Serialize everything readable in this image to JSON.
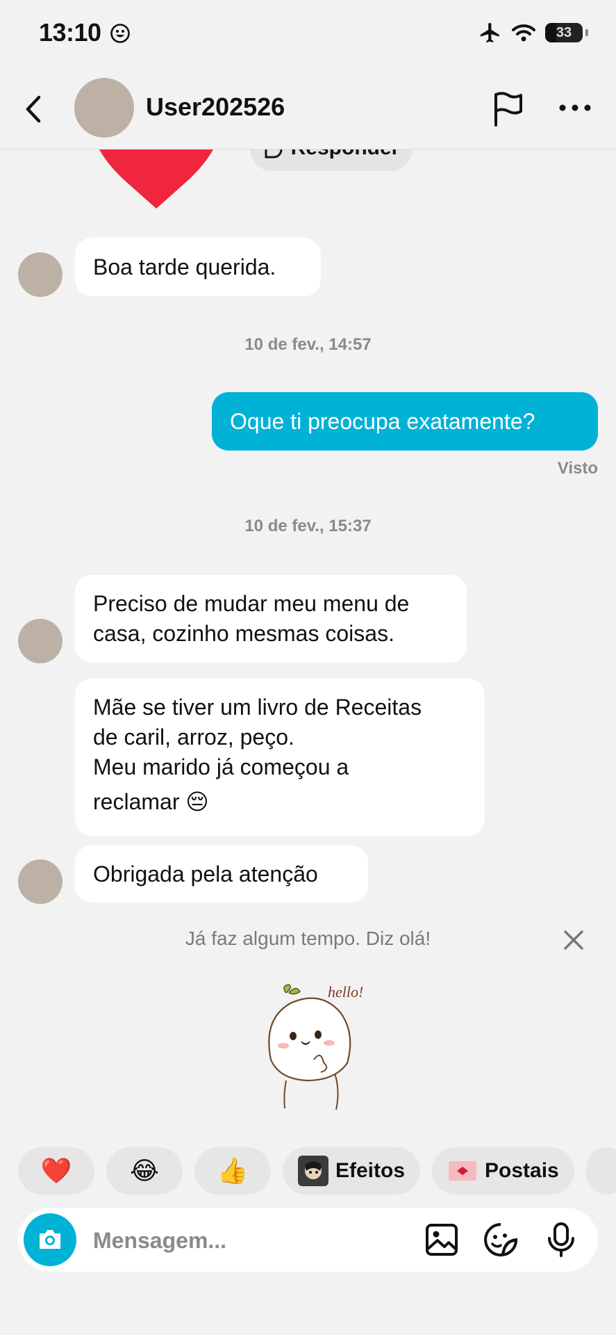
{
  "status_bar": {
    "time": "13:10",
    "battery": "33"
  },
  "header": {
    "username": "User202526"
  },
  "chat": {
    "reply_label": "Responder",
    "messages": [
      {
        "side": "in",
        "text": "Boa tarde querida."
      },
      {
        "type": "timestamp",
        "text": "10 de fev., 14:57"
      },
      {
        "side": "out",
        "text": "Oque ti preocupa exatamente?"
      },
      {
        "type": "status",
        "text": "Visto"
      },
      {
        "type": "timestamp",
        "text": "10 de fev., 15:37"
      },
      {
        "side": "in",
        "lines": [
          "Preciso de mudar meu menu de",
          "casa, cozinho mesmas coisas."
        ]
      },
      {
        "side": "in",
        "lines": [
          "Mãe se tiver um livro de Receitas",
          "de caril, arroz, peço.",
          "Meu marido já começou a",
          "reclamar 😔"
        ]
      },
      {
        "side": "in",
        "text": "Obrigada pela atenção"
      }
    ],
    "hint": "Já faz algum tempo. Diz olá!",
    "sticker_text": "hello!"
  },
  "quick_reactions": [
    {
      "type": "emoji",
      "value": "❤️"
    },
    {
      "type": "emoji",
      "value": "😂"
    },
    {
      "type": "emoji",
      "value": "👍"
    },
    {
      "type": "text",
      "label": "Efeitos"
    },
    {
      "type": "text",
      "label": "Postais"
    }
  ],
  "composer": {
    "placeholder": "Mensagem..."
  },
  "colors": {
    "accent": "#00b2d6",
    "background": "#f2f2f2",
    "bubble_in": "#ffffff",
    "avatar": "#bdb1a6",
    "heart": "#f0263f"
  }
}
